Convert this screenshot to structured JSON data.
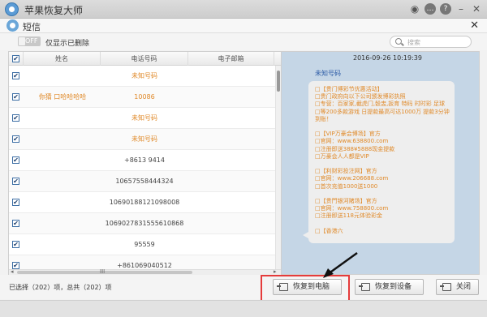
{
  "app": {
    "title": "苹果恢复大师"
  },
  "dialog": {
    "title": "短信"
  },
  "filter": {
    "toggle_label": "OFF",
    "show_deleted_label": "仅显示已删除",
    "search_placeholder": "搜索"
  },
  "table": {
    "columns": [
      "姓名",
      "电话号码",
      "电子邮箱"
    ],
    "rows": [
      {
        "name": "",
        "phone": "未知号码",
        "checked": "✔"
      },
      {
        "name": "你猜  口哈哈哈哈",
        "phone": "10086",
        "checked": "✔"
      },
      {
        "name": "",
        "phone": "未知号码",
        "checked": "✔"
      },
      {
        "name": "",
        "phone": "未知号码",
        "checked": "✔"
      },
      {
        "name": "",
        "phone": "+8613          9414",
        "checked": "✔"
      },
      {
        "name": "",
        "phone": "10657558444324",
        "checked": "✔"
      },
      {
        "name": "",
        "phone": "10690188121098008",
        "checked": "✔"
      },
      {
        "name": "",
        "phone": "1069027831555610868",
        "checked": "✔"
      },
      {
        "name": "",
        "phone": "95559",
        "checked": "✔"
      },
      {
        "name": "",
        "phone": "+861069040512",
        "checked": "✔"
      }
    ],
    "header_check": "✔",
    "scroll_left": "◂",
    "scroll_mid": "III",
    "scroll_right": "▸"
  },
  "detail": {
    "timestamp": "2016-09-26 10:19:39",
    "sender": "未知号码",
    "message": "□【贵门博彩节优惠活动】\n□贵门政府向以下公司颁发博彩执照\n□专营：百家家,截虎门,骰盅,扳育 特码 时时彩 足球\n□等200多款游戏 日提款最高可达1000万 提款3分钟到账！\n\n□【VIP万豪会博场】官方\n□官网：www.638800.com\n□注册即送388¥5888现金提款\n□万豪会人人都是VIP\n\n□【利财彩投注网】官方\n□官网：www.206688.com\n□首次充值1000送1000\n\n□【贵門银河赌场】官方\n□官网：www.758800.com\n□注册即送118元体验彩金\n\n□【香港六"
  },
  "footer": {
    "status": "已选择（202）项，总共（202）项",
    "restore_pc": "恢复到电脑",
    "restore_device": "恢复到设备",
    "close": "关闭"
  },
  "colors": {
    "accent_orange": "#e08a2a",
    "detail_bg": "#c5d6e6",
    "highlight_red": "#e53b3b",
    "sender_blue": "#2a5aa5"
  }
}
